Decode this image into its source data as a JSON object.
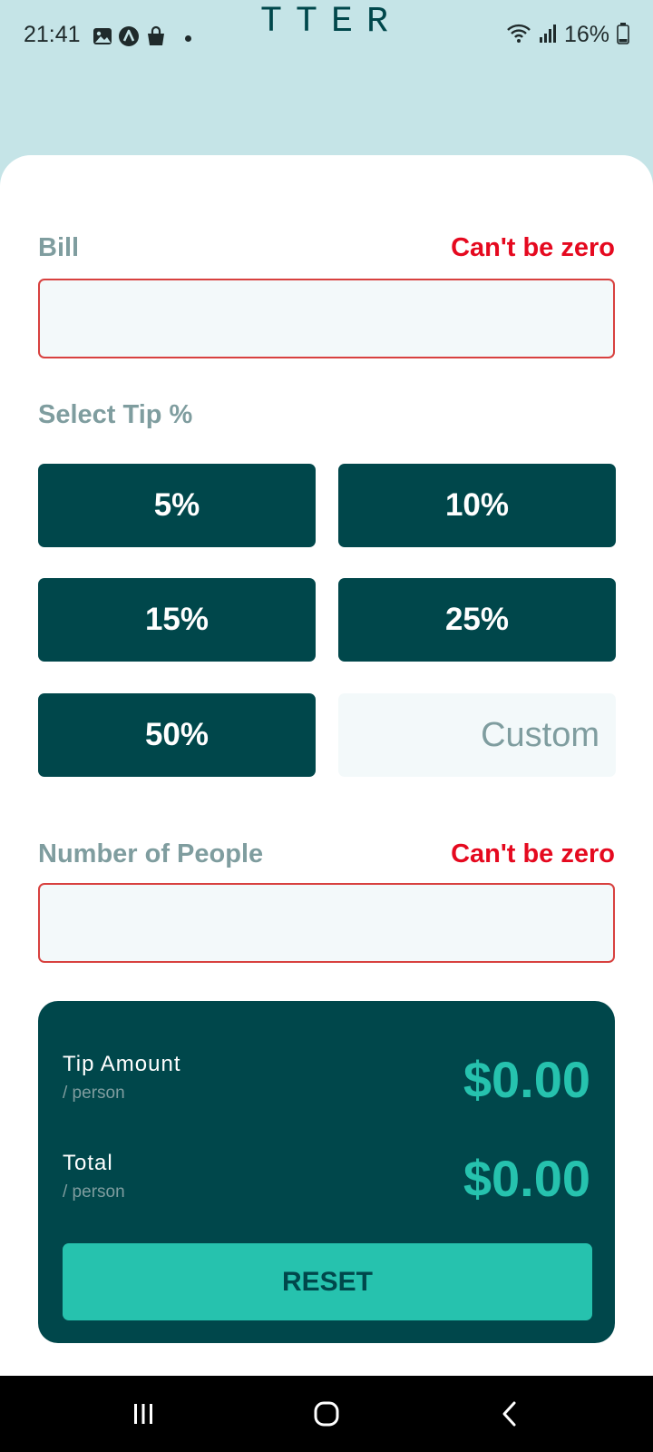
{
  "status_bar": {
    "time": "21:41",
    "battery": "16%",
    "icons": [
      "gallery-icon",
      "app-icon",
      "shopping-bag-icon",
      "notification-dot-icon",
      "wifi-icon",
      "signal-icon",
      "battery-icon"
    ]
  },
  "header": {
    "title_visible": "TTER"
  },
  "bill": {
    "label": "Bill",
    "error": "Can't be zero",
    "value": ""
  },
  "tip": {
    "label": "Select Tip %",
    "options": [
      "5%",
      "10%",
      "15%",
      "25%",
      "50%"
    ],
    "custom_placeholder": "Custom"
  },
  "people": {
    "label": "Number of People",
    "error": "Can't be zero",
    "value": ""
  },
  "results": {
    "tip_amount_label": "Tip Amount",
    "tip_amount_sub": "/ person",
    "tip_amount_value": "$0.00",
    "total_label": "Total",
    "total_sub": "/ person",
    "total_value": "$0.00",
    "reset_label": "RESET"
  },
  "nav": {
    "icons": [
      "recent-apps-icon",
      "home-icon",
      "back-icon"
    ]
  },
  "colors": {
    "background": "#c5e4e7",
    "primary": "#00474b",
    "accent": "#26c2ae",
    "error": "#e5091f",
    "label": "#7f9d9f",
    "input_bg": "#f3f9fa"
  }
}
